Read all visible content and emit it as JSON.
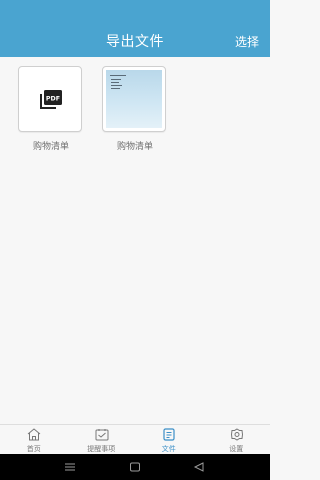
{
  "header": {
    "title": "导出文件",
    "select_label": "选择"
  },
  "files": [
    {
      "name": "购物清单",
      "icon": "pdf-file-icon",
      "badge": "PDF"
    },
    {
      "name": "购物清单",
      "icon": "image-preview"
    }
  ],
  "tabs": [
    {
      "label": "首页",
      "icon": "home-icon"
    },
    {
      "label": "提醒事项",
      "icon": "reminder-icon"
    },
    {
      "label": "文件",
      "icon": "file-icon",
      "active": true
    },
    {
      "label": "设置",
      "icon": "gear-icon"
    }
  ],
  "system_nav": {
    "icons": [
      "menu-icon",
      "home-square-icon",
      "back-triangle-icon"
    ]
  },
  "colors": {
    "header": "#4aa4d0",
    "accent": "#3b8fc7",
    "background": "#f7f7f7"
  }
}
